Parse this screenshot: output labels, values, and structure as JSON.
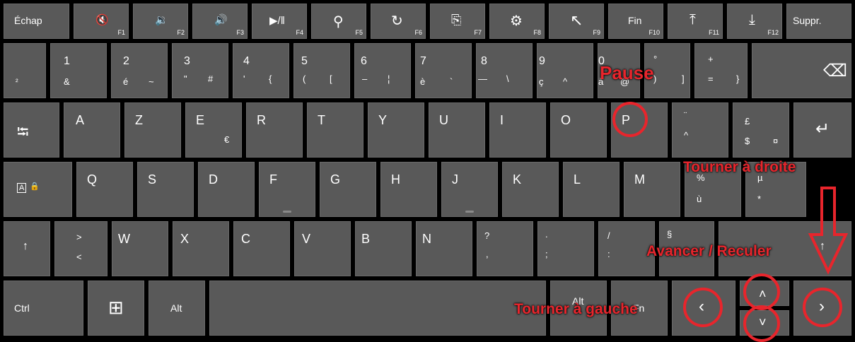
{
  "row_fn": [
    {
      "name": "key-escape",
      "main": "Échap",
      "fn": ""
    },
    {
      "name": "key-f1",
      "icon": "🔇",
      "fn": "F1",
      "icon_name": "mute-icon"
    },
    {
      "name": "key-f2",
      "icon": "🔉",
      "fn": "F2",
      "icon_name": "volume-down-icon"
    },
    {
      "name": "key-f3",
      "icon": "🔊",
      "fn": "F3",
      "icon_name": "volume-up-icon"
    },
    {
      "name": "key-f4",
      "icon": "▶/‖",
      "fn": "F4",
      "icon_name": "play-pause-icon"
    },
    {
      "name": "key-f5",
      "icon": "⚲",
      "fn": "F5",
      "icon_name": "search-icon"
    },
    {
      "name": "key-f6",
      "icon": "↻",
      "fn": "F6",
      "icon_name": "share-icon"
    },
    {
      "name": "key-f7",
      "icon": "⎘",
      "fn": "F7",
      "icon_name": "devices-icon"
    },
    {
      "name": "key-f8",
      "icon": "⚙",
      "fn": "F8",
      "icon_name": "settings-gear-icon"
    },
    {
      "name": "key-f9",
      "icon": "↖",
      "fn": "F9",
      "icon_name": "home-arrow-icon"
    },
    {
      "name": "key-f10",
      "main": "Fin",
      "fn": "F10"
    },
    {
      "name": "key-f11",
      "icon": "⤒",
      "fn": "F11",
      "icon_name": "page-up-icon"
    },
    {
      "name": "key-f12",
      "icon": "⤓",
      "fn": "F12",
      "icon_name": "page-down-icon"
    },
    {
      "name": "key-delete",
      "main": "Suppr.",
      "fn": ""
    }
  ],
  "row_num": [
    {
      "top": "",
      "bot": "²"
    },
    {
      "top": "1",
      "bot": "&"
    },
    {
      "top": "2",
      "bot": "é",
      "alt": "~"
    },
    {
      "top": "3",
      "bot": "\"",
      "alt": "#"
    },
    {
      "top": "4",
      "bot": "'",
      "alt": "{"
    },
    {
      "top": "5",
      "bot": "(",
      "alt": "["
    },
    {
      "top": "6",
      "bot": "–",
      "alt": "¦"
    },
    {
      "top": "7",
      "bot": "è",
      "alt": "`"
    },
    {
      "top": "8",
      "bot": "—",
      "alt": "\\"
    },
    {
      "top": "9",
      "bot": "ç",
      "alt": "^"
    },
    {
      "top": "0",
      "bot": "à",
      "alt": "@"
    },
    {
      "top": "°",
      "bot": ")",
      "alt": "]"
    },
    {
      "top": "+",
      "bot": "=",
      "alt": "}"
    }
  ],
  "backspace_icon": "⌫",
  "row_q": [
    "A",
    "Z",
    "E",
    "R",
    "T",
    "Y",
    "U",
    "I",
    "O",
    "P"
  ],
  "e_alt": "€",
  "key_trema": {
    "top": "¨",
    "bot": "^"
  },
  "key_pound": {
    "top": "£",
    "bot": "$",
    "alt": "¤"
  },
  "tab_icon": "⭾",
  "enter_icon": "↵",
  "row_a": [
    "Q",
    "S",
    "D",
    "F",
    "G",
    "H",
    "J",
    "K",
    "L",
    "M"
  ],
  "key_percent": {
    "top": "%",
    "bot": "ù"
  },
  "key_mu": {
    "top": "µ",
    "bot": "*"
  },
  "caps_icon": "🔒",
  "caps_letter": "A",
  "row_w": [
    "W",
    "X",
    "C",
    "V",
    "B",
    "N"
  ],
  "shift_icon": "↑",
  "key_lt": {
    "top": ">",
    "bot": "<"
  },
  "key_q": {
    "top": "?",
    "bot": ","
  },
  "key_dot": {
    "top": ".",
    "bot": ";"
  },
  "key_slash": {
    "top": "/",
    "bot": ":"
  },
  "key_sect": {
    "top": "§",
    "bot": "!"
  },
  "bottom": {
    "ctrl": "Ctrl",
    "win_icon": "⊞",
    "alt": "Alt",
    "altgr": "Alt",
    "fn": "Fn",
    "left": "‹",
    "up": "˄",
    "down": "˅",
    "right": "›"
  },
  "annotations": {
    "pause": "Pause",
    "turn_right": "Tourner à droite",
    "forward_back": "Avancer / Reculer",
    "turn_left": "Tourner à gauche"
  },
  "colors": {
    "key": "#595959",
    "annotation": "#e8252c",
    "background": "#000000"
  }
}
